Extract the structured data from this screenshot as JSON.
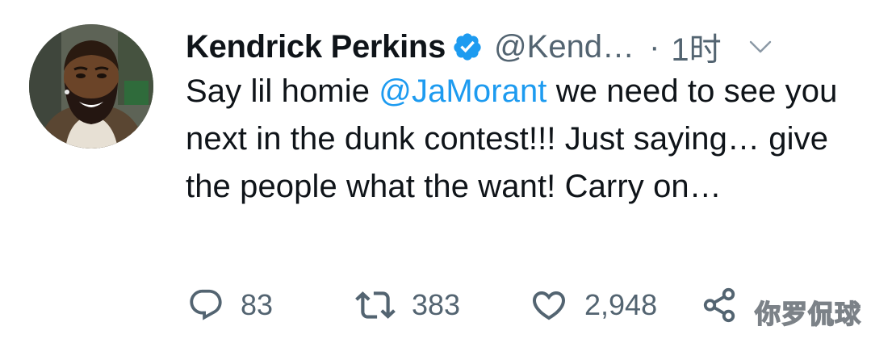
{
  "tweet": {
    "author_name": "Kendrick Perkins",
    "handle": "@Kend…",
    "separator": "·",
    "time": "1时",
    "text_before": "Say lil homie ",
    "mention": "@JaMorant",
    "text_after": " we need to see you next in the dunk contest!!! Just saying… give the people what the want! Carry on…"
  },
  "actions": {
    "replies": "83",
    "retweets": "383",
    "likes": "2,948"
  },
  "icons": {
    "avatar": "avatar-cartoon",
    "verified": "verified-badge-icon",
    "more": "chevron-down-icon",
    "reply": "reply-icon",
    "retweet": "retweet-icon",
    "like": "heart-icon",
    "share": "share-icon"
  },
  "colors": {
    "text": "#0f1419",
    "secondary": "#536471",
    "accent": "#1d9bf0"
  },
  "watermark": "你罗侃球"
}
